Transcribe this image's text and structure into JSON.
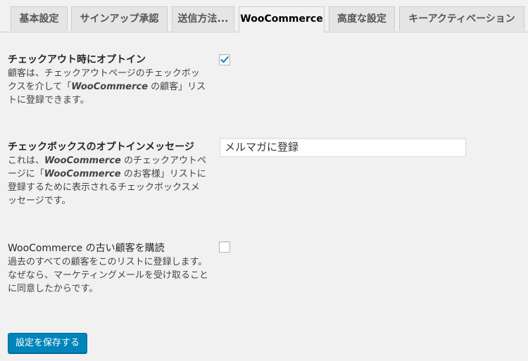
{
  "tabs": [
    {
      "label": "基本設定"
    },
    {
      "label": "サインアップ承認"
    },
    {
      "label": "送信方法..."
    },
    {
      "label": "WooCommerce"
    },
    {
      "label": "高度な設定"
    },
    {
      "label": "キーアクティベーション"
    }
  ],
  "active_tab": "WooCommerce",
  "settings": {
    "checkout_optin": {
      "title": "チェックアウト時にオプトイン",
      "desc_lead": "顧客は、チェックアウトページのチェックボックスを介して「",
      "desc_em": "WooCommerce",
      "desc_tail": " の顧客」リストに登録できます。",
      "checked": true
    },
    "optin_message": {
      "title": "チェックボックスのオプトインメッセージ",
      "desc_lead": "これは、",
      "desc_em": "WooCommerce",
      "desc_mid": " のチェックアウトページに「",
      "desc_em2": "WooCommerce",
      "desc_tail": " のお客様」リストに登録するために表示されるチェックボックスメッセージです。",
      "value": "メルマガに登録"
    },
    "old_customers": {
      "title": "WooCommerce の古い顧客を購読",
      "desc": "過去のすべての顧客をこのリストに登録します。なぜなら、マーケティングメールを受け取ることに同意したからです。",
      "checked": false
    }
  },
  "save_button_label": "設定を保存する",
  "colors": {
    "primary": "#0085ba",
    "checkmark": "#1e8cbe",
    "background": "#f1f1f1"
  }
}
